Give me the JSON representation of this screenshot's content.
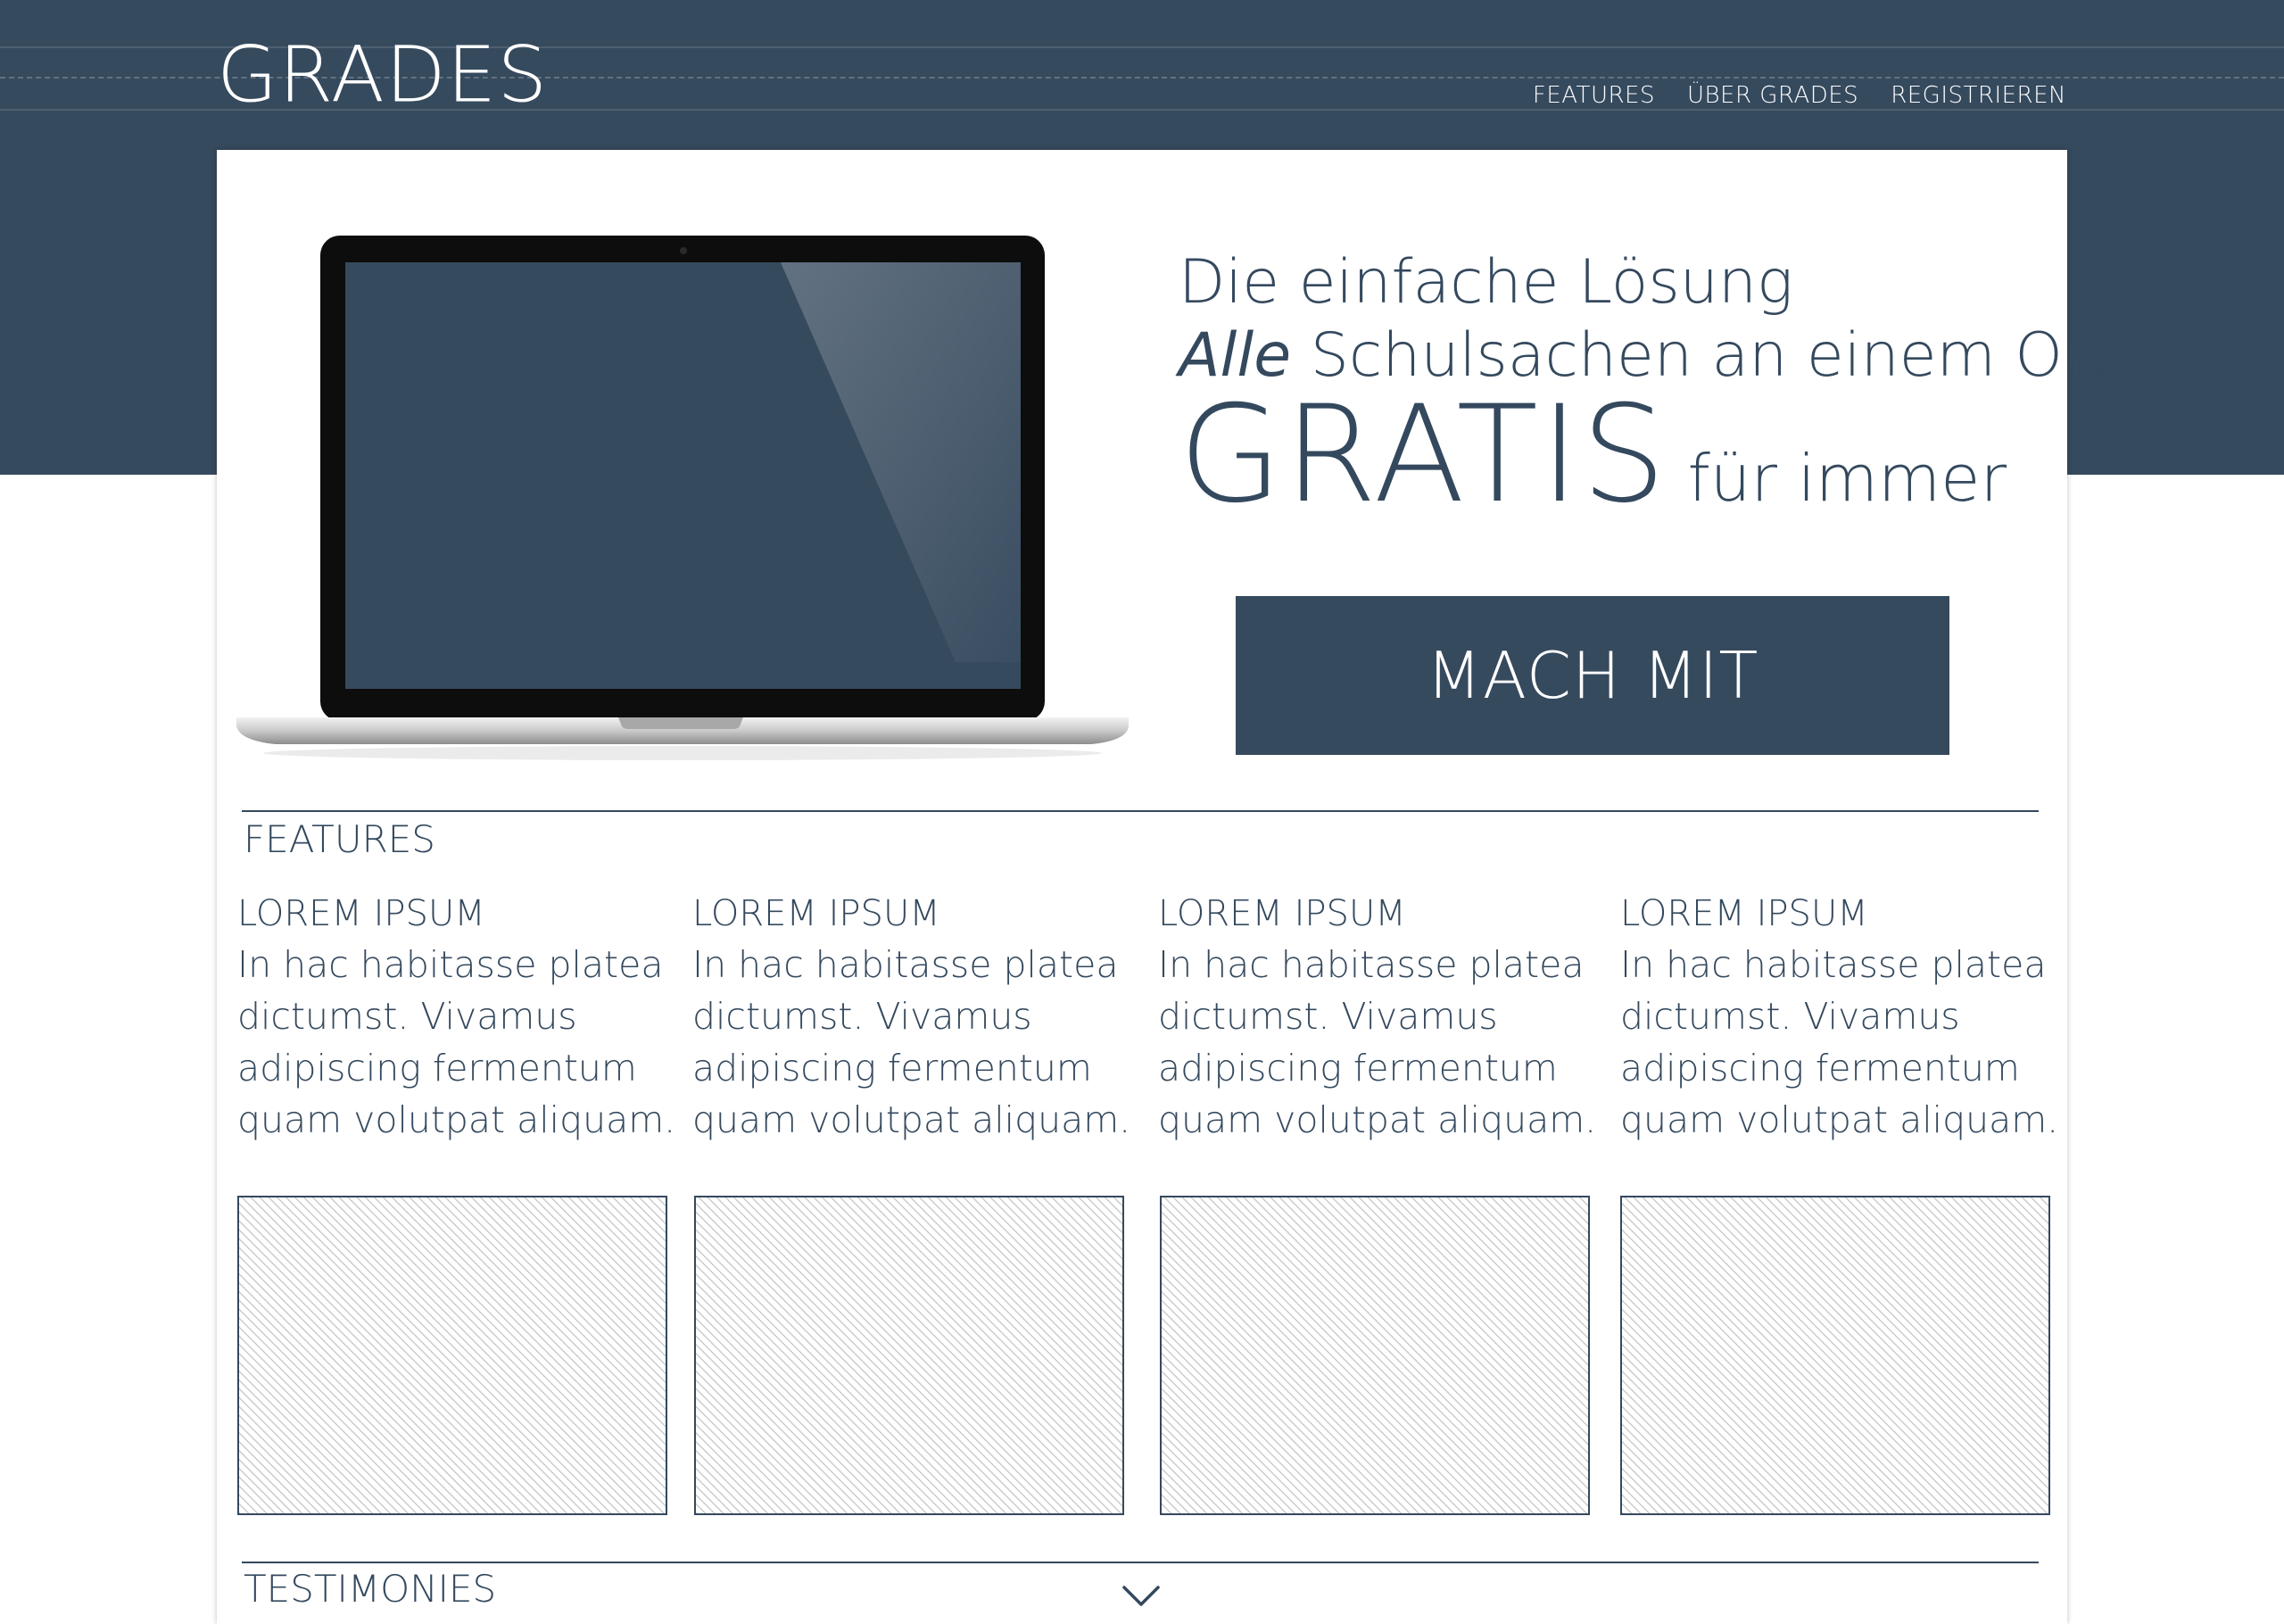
{
  "header": {
    "logo": "GRADES",
    "nav": [
      "FEATURES",
      "ÜBER GRADES",
      "REGISTRIEREN"
    ]
  },
  "hero": {
    "line1": "Die einfache Lösung",
    "line2_em": "Alle",
    "line2_rest": " Schulsachen an einem Ort",
    "gratis": "GRATIS",
    "forever": "für immer",
    "cta": "MACH MIT"
  },
  "features": {
    "label": "FEATURES",
    "items": [
      {
        "title": "LOREM IPSUM",
        "text": "In hac habitasse platea dictumst. Vivamus adipiscing fermentum quam volutpat aliquam."
      },
      {
        "title": "LOREM IPSUM",
        "text": "In hac habitasse platea dictumst. Vivamus adipiscing fermentum quam volutpat aliquam."
      },
      {
        "title": "LOREM IPSUM",
        "text": "In hac habitasse platea dictumst. Vivamus adipiscing fermentum quam volutpat aliquam."
      },
      {
        "title": "LOREM IPSUM",
        "text": "In hac habitasse platea dictumst. Vivamus adipiscing fermentum quam volutpat aliquam."
      }
    ]
  },
  "testimonies": {
    "label": "TESTIMONIES"
  },
  "icons": {
    "scroll": "chevron-down-icon",
    "laptop": "laptop-illustration"
  },
  "colors": {
    "primary": "#364a5e",
    "text": "#34495e",
    "background": "#ffffff"
  }
}
